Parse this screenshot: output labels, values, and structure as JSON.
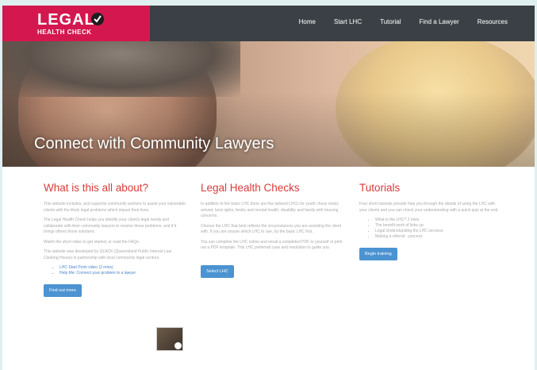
{
  "logo": {
    "main": "LEGAL",
    "sub": "HEALTH CHECK"
  },
  "nav": {
    "items": [
      "Home",
      "Start LHC",
      "Tutorial",
      "Find a Lawyer",
      "Resources"
    ]
  },
  "hero": {
    "title": "Connect with Community Lawyers"
  },
  "colors": {
    "brand": "#d4184f",
    "header_bg": "#3a4045",
    "heading": "#d93b3b",
    "button": "#4b93d1"
  },
  "col1": {
    "heading": "What is this all about?",
    "paragraphs": [
      "This website includes, and supports community workers to assist your vulnerable clients with the likely legal problems which impact their lives.",
      "The Legal Health Check helps you identify your client's legal needs and collaborate with their community lawyers to resolve those problems, and if it brings others those solutions.",
      "Watch the short video to get started, or read the FAQs.",
      "This website was developed by QLACK (Queensland Public Interest Law Clearing House) in partnership with local community legal centres."
    ],
    "links": [
      "LHC Start Point video (2 mins)",
      "Help Me: Connect your problem to a lawyer"
    ],
    "button": "Find out more"
  },
  "col2": {
    "heading": "Legal Health Checks",
    "paragraphs": [
      "In addition to the basic LHC there are five tailored LHCs for youth; those newly arrived; land rights, family and mental health; disability and family with housing concerns.",
      "Choose the LHC that best reflects the circumstances you are assisting the client with. If you are unsure which LHC to use, try the basic LHC first.",
      "You can complete the LHC online and email a completed PDF to yourself or print out a PDF template. This LHC preferred case and resolution to guide you."
    ],
    "button": "Select LHC"
  },
  "col3": {
    "heading": "Tutorials",
    "paragraphs": [
      "Four short tutorials provide help you through the details of using the LHC with your clients and you can check your understanding with a quick quiz at the end."
    ],
    "items": [
      "What is the LHC? 2 mins",
      "The benefit work of links up",
      "Legal Understanding the LHC services",
      "Making a referral - process"
    ],
    "button": "Begin training"
  }
}
